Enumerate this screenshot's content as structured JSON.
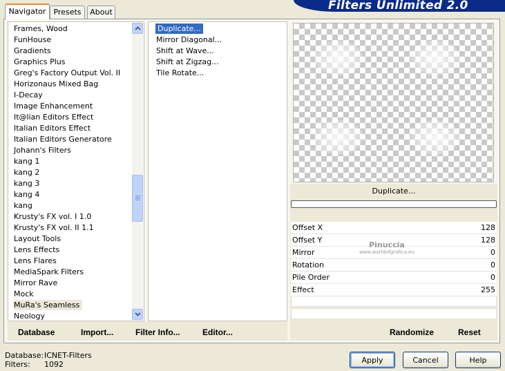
{
  "banner": {
    "title": "Filters Unlimited 2.0"
  },
  "tabs": [
    {
      "label": "Navigator",
      "active": true
    },
    {
      "label": "Presets",
      "active": false
    },
    {
      "label": "About",
      "active": false
    }
  ],
  "categories": {
    "items": [
      "Frames, Wood",
      "FunHouse",
      "Gradients",
      "Graphics Plus",
      "Greg's Factory Output Vol. II",
      "Horizonaus Mixed Bag",
      "I-Decay",
      "Image Enhancement",
      "It@lian Editors Effect",
      "Italian Editors Effect",
      "Italian Editors Generatore",
      "Johann's Filters",
      "kang 1",
      "kang 2",
      "kang 3",
      "kang 4",
      "kang",
      "Krusty's FX vol. I 1.0",
      "Krusty's FX vol. II 1.1",
      "Layout Tools",
      "Lens Effects",
      "Lens Flares",
      "MediaSpark Filters",
      "Mirror Rave",
      "Mock",
      "MuRa's Seamless",
      "Neology"
    ],
    "selected_index": 25
  },
  "filters": {
    "items": [
      "Duplicate...",
      "Mirror Diagonal...",
      "Shift at Wave...",
      "Shift at Zigzag...",
      "Tile Rotate..."
    ],
    "selected_index": 0
  },
  "left_buttons": {
    "database": "Database",
    "import": "Import...",
    "filter_info": "Filter Info...",
    "editor": "Editor..."
  },
  "preview": {
    "filter_name": "Duplicate...",
    "watermark": "Pinuccia",
    "watermark_sub": "www.worldofgrafica.eu"
  },
  "params": [
    {
      "name": "Offset X",
      "value": "128"
    },
    {
      "name": "Offset Y",
      "value": "128"
    },
    {
      "name": "Mirror",
      "value": "0"
    },
    {
      "name": "Rotation",
      "value": "0"
    },
    {
      "name": "Pile Order",
      "value": "0"
    },
    {
      "name": "Effect",
      "value": "255"
    }
  ],
  "right_buttons": {
    "randomize": "Randomize",
    "reset": "Reset"
  },
  "status": {
    "database_label": "Database:",
    "database_value": "ICNET-Filters",
    "filters_label": "Filters:",
    "filters_value": "1092"
  },
  "dialog_buttons": {
    "apply": "Apply",
    "cancel": "Cancel",
    "help": "Help"
  },
  "colors": {
    "banner": "#0a2a8a",
    "selection": "#316ac5",
    "tab_accent": "#e68b2c"
  }
}
